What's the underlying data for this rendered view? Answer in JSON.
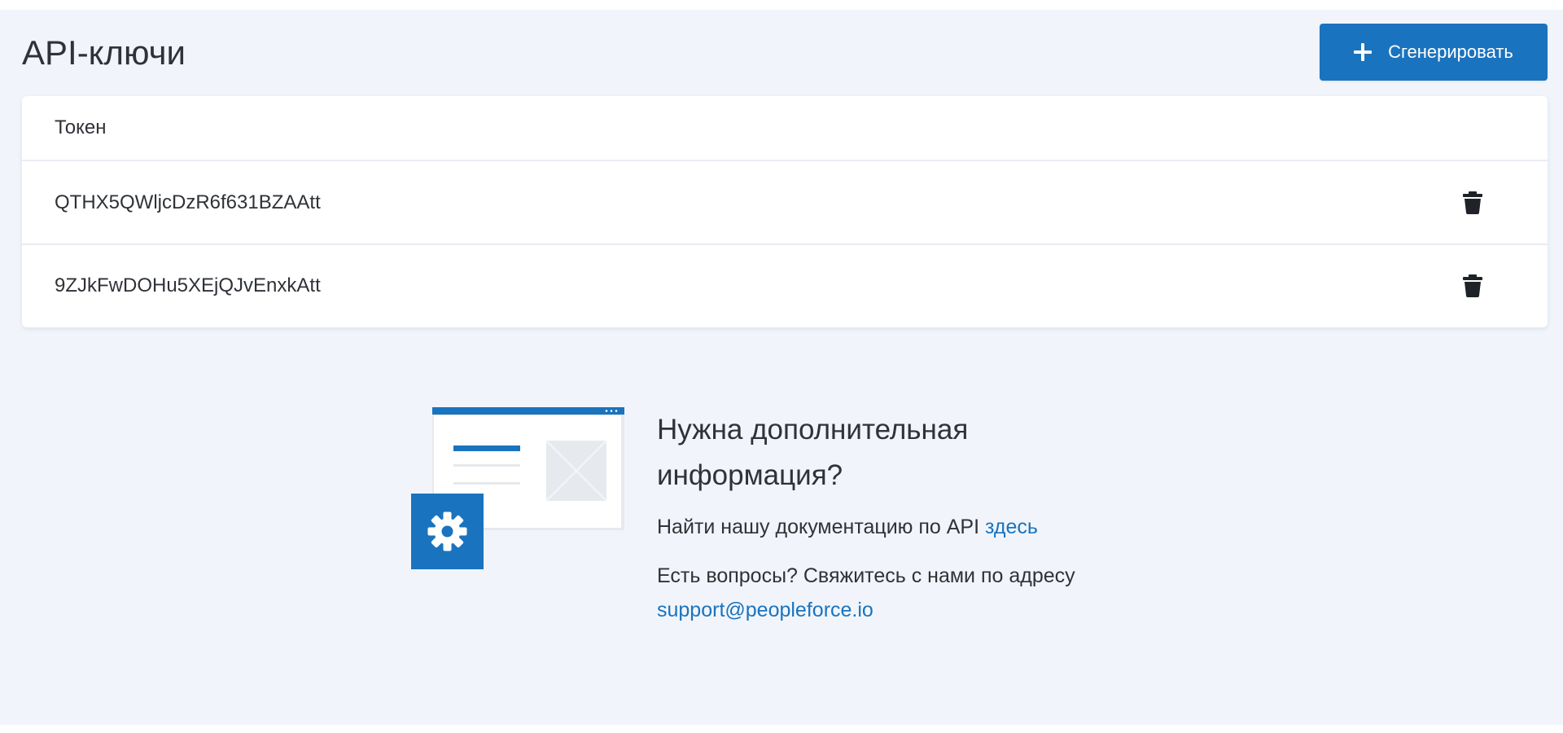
{
  "header": {
    "title": "API-ключи",
    "generate_label": "Сгенерировать"
  },
  "table": {
    "column_token": "Токен",
    "rows": [
      {
        "token": "QTHX5QWljcDzR6f631BZAAtt"
      },
      {
        "token": "9ZJkFwDOHu5XEjQJvEnxkAtt"
      }
    ]
  },
  "help": {
    "title": "Нужна дополнительная информация?",
    "docs_text": "Найти нашу документацию по API",
    "docs_link": "здесь",
    "contact_text": "Есть вопросы? Свяжитесь с нами по адресу",
    "contact_email": "support@peopleforce.io"
  },
  "icons": {
    "generate": "plus-icon",
    "delete": "trash-icon",
    "illustration_badge": "gear-icon"
  },
  "colors": {
    "accent": "#1a73be",
    "background": "#f1f5fb",
    "card": "#ffffff",
    "text": "#2f3237"
  }
}
